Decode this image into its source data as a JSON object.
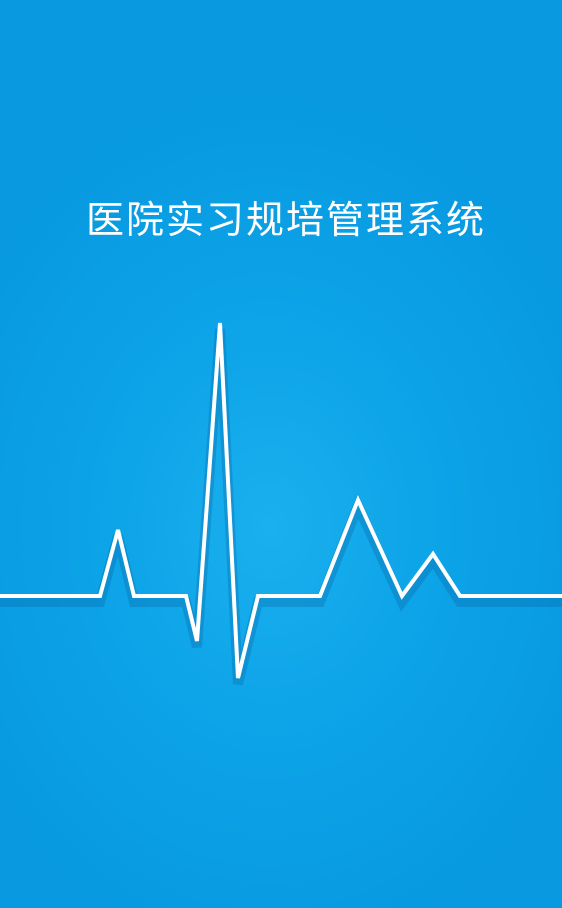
{
  "app": {
    "title": "医院实习规培管理系统"
  },
  "colors": {
    "background": "#0da4e8",
    "line": "#ffffff",
    "title_text": "#ffffff"
  },
  "icons": {
    "heartbeat": "heartbeat-icon"
  }
}
